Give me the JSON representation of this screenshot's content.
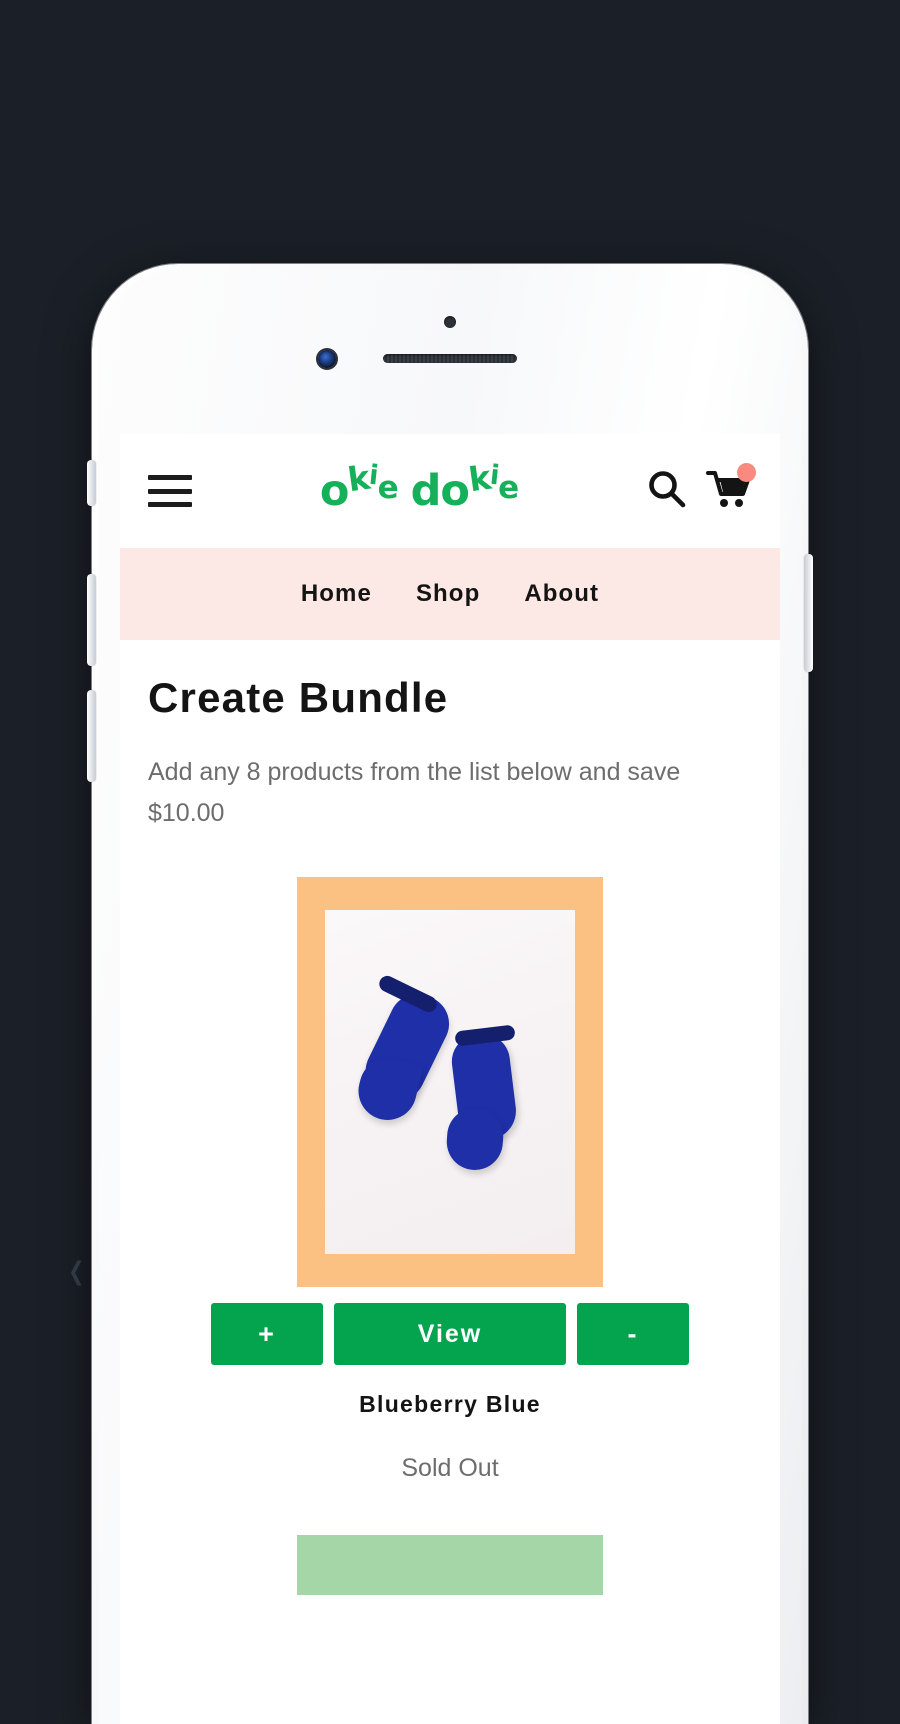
{
  "theme": {
    "backdrop_color": "#1b2028",
    "brand_green": "#14b15a",
    "button_green": "#04a44f",
    "nav_pink": "#fce8e4",
    "frame_orange": "#fac183",
    "next_card_green": "#a4d6a7",
    "cart_badge_color": "#f98a80",
    "sock_blue": "#1f2fa8"
  },
  "backdrop": {
    "arrow_glyph": "❮"
  },
  "header": {
    "menu_icon": "hamburger-icon",
    "logo": {
      "letters": [
        "o",
        "k",
        "i",
        "e",
        " ",
        "d",
        "o",
        "k",
        "i",
        "e"
      ],
      "text": "okie dokie"
    },
    "search_icon": "search-icon",
    "cart_icon": "shopping-cart-icon",
    "cart_badge": ""
  },
  "nav": {
    "items": [
      {
        "label": "Home"
      },
      {
        "label": "Shop"
      },
      {
        "label": "About"
      }
    ]
  },
  "main": {
    "title": "Create Bundle",
    "subtitle": "Add any 8 products from the list below and save $10.00",
    "products": [
      {
        "name": "Blueberry Blue",
        "stock_status": "Sold Out",
        "image_alt": "blue-socks-photo",
        "frame_color": "#fac183",
        "actions": {
          "add_label": "+",
          "view_label": "View",
          "remove_label": "-"
        }
      }
    ],
    "next_product_frame_color": "#a4d6a7"
  }
}
